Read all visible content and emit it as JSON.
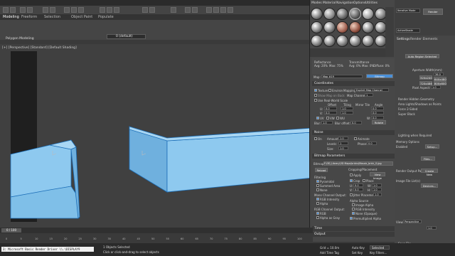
{
  "main_menu": [
    "Modeling",
    "Freeform",
    "Selection",
    "Object Paint",
    "Populate"
  ],
  "ribbon_tab_sub": "Polygon Modeling",
  "viewport_label": "[+] [Perspective] [Standard] [Default Shading]",
  "layer_dropdown": "0 (default)",
  "mat_editor": {
    "menu": [
      "Modes",
      "Material",
      "Navigation",
      "Options",
      "Utilities"
    ],
    "reflectance": {
      "title": "Reflectance",
      "avg": "Avg: 20%",
      "max": "Max: 75%"
    },
    "transmittance": {
      "title": "Transmittance",
      "avg": "Avg: 0%",
      "max": "Max: 0%",
      "diffuse": "Diffuse: 0%"
    },
    "map_label": "Map:",
    "map_name": "Map #19",
    "map_type": "Bitmap",
    "coordinates": {
      "title": "Coordinates",
      "texture": "Texture",
      "environ": "Environ",
      "mapping_label": "Mapping:",
      "mapping_value": "Explicit Map Channel",
      "show_map_back": "Show Map on Back",
      "map_channel": "Map Channel:",
      "map_channel_val": "1",
      "use_real_world": "Use Real-World Scale",
      "offset": "Offset",
      "tiling": "Tiling",
      "mirror_tile": "Mirror Tile",
      "angle": "Angle",
      "u": "U:",
      "v": "V:",
      "uv": "UV",
      "vw": "VW",
      "wu": "WU",
      "w": "W:",
      "zero": "0.0",
      "one": "1.0",
      "blur": "Blur:",
      "blur_val": "1.0",
      "blur_offset": "Blur offset:",
      "blur_offset_val": "0.0",
      "rotate": "Rotate"
    },
    "noise": {
      "title": "Noise",
      "on": "On",
      "amount": "Amount:",
      "amount_val": "1.0",
      "levels": "Levels:",
      "levels_val": "1",
      "size": "Size:",
      "size_val": "1.0",
      "animate": "Animate",
      "phase": "Phase:",
      "phase_val": "0.0"
    },
    "bitmap_params": {
      "title": "Bitmap Parameters",
      "bitmap_label": "Bitmap:",
      "bitmap_path": "F:\\3D_Library\\3D Maps\\bricks\\Mosaic_brick_G.jpg",
      "reload": "Reload",
      "cropping": "Cropping/Placement",
      "view_image": "View Image",
      "apply": "Apply",
      "crop": "Crop",
      "place": "Place",
      "filtering": "Filtering",
      "pyramidal": "Pyramidal",
      "summed_area": "Summed Area",
      "none": "None",
      "mono_output": "Mono Channel Output:",
      "rgb_intensity": "RGB Intensity",
      "alpha": "Alpha",
      "rgb_output": "RGB Channel Output:",
      "rgb": "RGB",
      "alpha_as_gray": "Alpha as Gray",
      "alpha_source": "Alpha Source",
      "image_alpha": "Image Alpha",
      "rgb_intensity2": "RGB Intensity",
      "none_opaque": "None (Opaque)",
      "premult": "Premultiplied Alpha",
      "u_lbl": "U:",
      "v_lbl": "V:",
      "w_lbl": "W:",
      "h_lbl": "H:",
      "u_val": "0.0",
      "v_val": "0.0",
      "w_val": "1.0",
      "h_val": "1.0",
      "jitter": "Jitter Placement:",
      "jitter_val": "1.0"
    },
    "time": "Time",
    "output": "Output"
  },
  "render_setup": {
    "top_dropdown": "Iterative Mode",
    "render_button": "Render",
    "tabs": [
      "Settings",
      "Render Elements"
    ],
    "renderer": "ActiveShade",
    "auto_region": "Auto Region Selected",
    "aperture_width": "Aperture Width(mm):",
    "aperture_val": "36.0",
    "res": [
      "320x240",
      "640x480",
      "720x486",
      "800x600"
    ],
    "pixel_aspect": "Pixel Aspect:",
    "pixel_aspect_val": "1.0",
    "render_hidden": "Render Hidden Geometry",
    "area_lights": "Area Lights/Shadows as Points",
    "force_2sided": "Force 2-Sided",
    "super_black": "Super Black",
    "lighting_required": "Lighting when Required",
    "memory_options": "Memory Options",
    "enabled": "Enabled",
    "setup": "Setup...",
    "files": "Files...",
    "render_output": "Render Output Path(s)",
    "create_new": "Create New",
    "put_image_file": "Image File List(s)",
    "devices": "Devices...",
    "view_val": "1.0",
    "save_file": "Save File",
    "view_label": "View:",
    "view_name": "Perspective"
  },
  "status": {
    "objects_selected": "1 Objects Selected",
    "hint": "Click or click-and-drag to select objects",
    "command_line": "3: Microsoft Basic Render Driver \\\\.\\DISPLAY9",
    "frame": "0 / 100",
    "grid": "Grid = 10.0m",
    "add_time_tag": "Add Time Tag",
    "set_key": "Set Key",
    "key_filters": "Key Filters...",
    "auto_key": "Auto Key",
    "selected": "Selected"
  },
  "timeline_ticks": [
    "0",
    "5",
    "10",
    "15",
    "20",
    "25",
    "30",
    "35",
    "40",
    "45",
    "50",
    "55",
    "60",
    "65",
    "70",
    "75",
    "80",
    "85",
    "90",
    "95",
    "100"
  ],
  "colors": {
    "selection_blue": "#8ec9ef",
    "selection_outline": "#1d6fb8",
    "accent_blue": "#4a90d9"
  }
}
